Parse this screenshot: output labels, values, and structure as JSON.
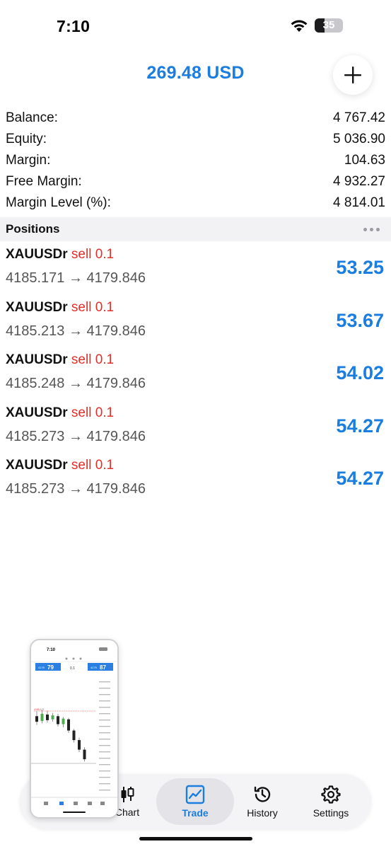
{
  "status_bar": {
    "time": "7:10",
    "battery": "35",
    "battery_level": 0.35
  },
  "header": {
    "title": "269.48 USD",
    "add_label": "+"
  },
  "summary": [
    {
      "label": "Balance:",
      "value": "4 767.42"
    },
    {
      "label": "Equity:",
      "value": "5 036.90"
    },
    {
      "label": "Margin:",
      "value": "104.63"
    },
    {
      "label": "Free Margin:",
      "value": "4 932.27"
    },
    {
      "label": "Margin Level (%):",
      "value": "4 814.01"
    }
  ],
  "positions_section": {
    "title": "Positions"
  },
  "positions": [
    {
      "symbol": "XAUUSDr",
      "side": "sell 0.1",
      "prices": "4185.171 → 4179.846",
      "profit": "53.25"
    },
    {
      "symbol": "XAUUSDr",
      "side": "sell 0.1",
      "prices": "4185.213 → 4179.846",
      "profit": "53.67"
    },
    {
      "symbol": "XAUUSDr",
      "side": "sell 0.1",
      "prices": "4185.248 → 4179.846",
      "profit": "54.02"
    },
    {
      "symbol": "XAUUSDr",
      "side": "sell 0.1",
      "prices": "4185.273 → 4179.846",
      "profit": "54.27"
    },
    {
      "symbol": "XAUUSDr",
      "side": "sell 0.1",
      "prices": "4185.273 → 4179.846",
      "profit": "54.27"
    }
  ],
  "pip": {
    "time": "7:10",
    "bid_small": "4179",
    "bid_big": "79",
    "ask_small": "4179",
    "ask_big": "87",
    "lot": "0.1",
    "sell_price_marker": "4185.171",
    "candles": [
      {
        "o": 4185.6,
        "c": 4184.9,
        "h": 4186.2,
        "l": 4184.5
      },
      {
        "o": 4185.0,
        "c": 4185.9,
        "h": 4186.4,
        "l": 4184.7
      },
      {
        "o": 4185.8,
        "c": 4185.1,
        "h": 4186.3,
        "l": 4184.8
      },
      {
        "o": 4185.2,
        "c": 4185.7,
        "h": 4186.0,
        "l": 4184.9
      },
      {
        "o": 4185.6,
        "c": 4184.6,
        "h": 4185.9,
        "l": 4184.3
      },
      {
        "o": 4184.6,
        "c": 4185.3,
        "h": 4185.5,
        "l": 4184.2
      },
      {
        "o": 4185.2,
        "c": 4183.8,
        "h": 4185.4,
        "l": 4183.5
      },
      {
        "o": 4183.8,
        "c": 4182.6,
        "h": 4184.0,
        "l": 4182.3
      },
      {
        "o": 4182.6,
        "c": 4181.4,
        "h": 4182.9,
        "l": 4181.1
      },
      {
        "o": 4181.4,
        "c": 4180.2,
        "h": 4181.7,
        "l": 4179.9
      }
    ]
  },
  "tabs": [
    {
      "label": "Chart",
      "icon": "candlestick-icon",
      "active": false
    },
    {
      "label": "Trade",
      "icon": "chart-trend-icon",
      "active": true
    },
    {
      "label": "History",
      "icon": "history-icon",
      "active": false
    },
    {
      "label": "Settings",
      "icon": "gear-icon",
      "active": false
    }
  ],
  "colors": {
    "accent": "#1a7de0",
    "sell": "#e0302a",
    "background": "#ffffff",
    "section": "#f2f2f4"
  }
}
